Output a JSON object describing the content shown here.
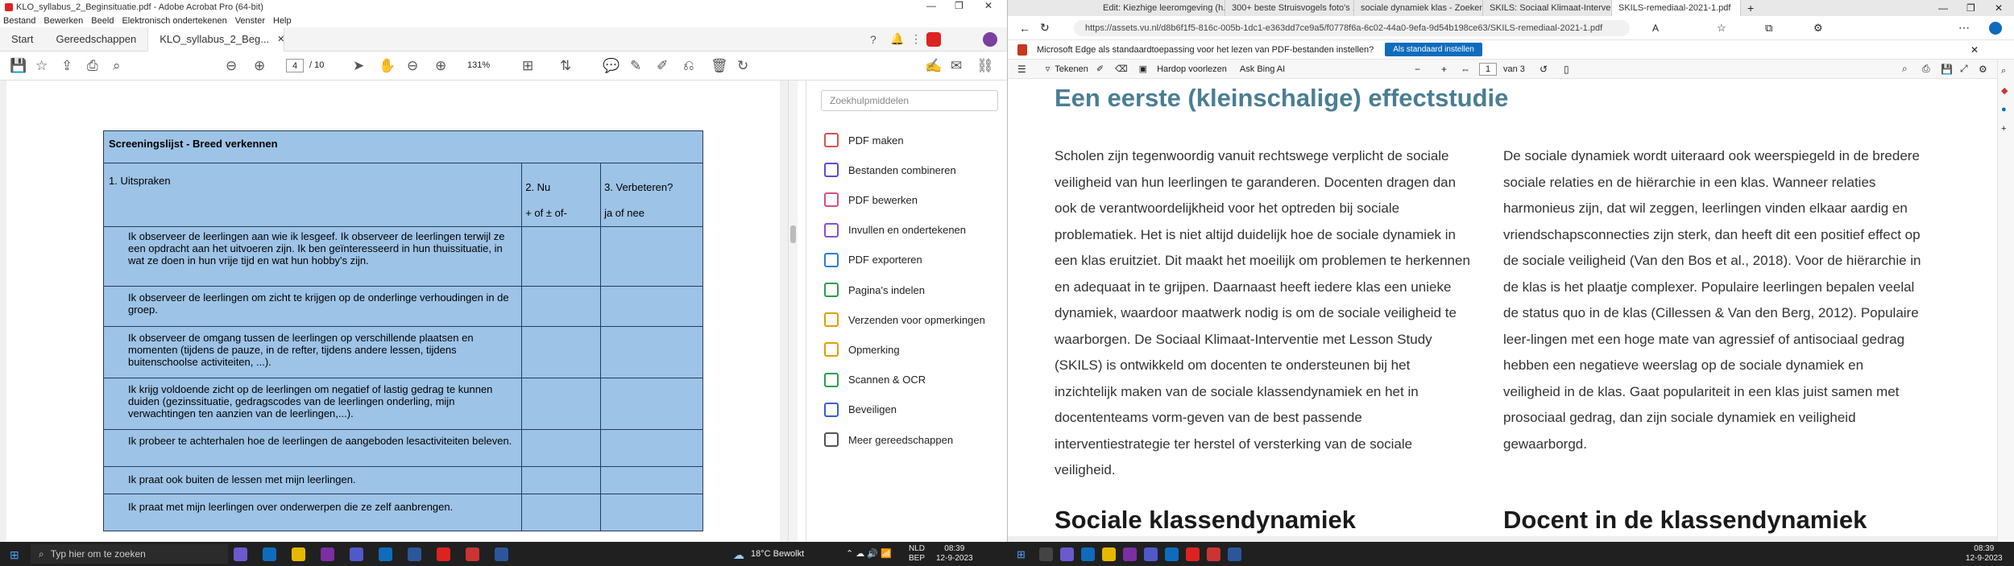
{
  "acrobat": {
    "title": "KLO_syllabus_2_Beginsituatie.pdf - Adobe Acrobat Pro (64-bit)",
    "menu": [
      "Bestand",
      "Bewerken",
      "Beeld",
      "Elektronisch ondertekenen",
      "Venster",
      "Help"
    ],
    "tabs": [
      "Start",
      "Gereedschappen"
    ],
    "doc_tab": "KLO_syllabus_2_Beg...",
    "page_current": "4",
    "page_total": "/ 10",
    "zoom": "131%",
    "search_placeholder": "Zoekhulpmiddelen",
    "tools": [
      {
        "label": "PDF maken",
        "color": "#d9534f"
      },
      {
        "label": "Bestanden combineren",
        "color": "#5a4fcf"
      },
      {
        "label": "PDF bewerken",
        "color": "#d94f7a"
      },
      {
        "label": "Invullen en ondertekenen",
        "color": "#8a4fd9"
      },
      {
        "label": "PDF exporteren",
        "color": "#2d7fd3"
      },
      {
        "label": "Pagina's indelen",
        "color": "#2e9e4f"
      },
      {
        "label": "Verzenden voor opmerkingen",
        "color": "#e0a000"
      },
      {
        "label": "Opmerking",
        "color": "#e0a000"
      },
      {
        "label": "Scannen & OCR",
        "color": "#2e9e4f"
      },
      {
        "label": "Beveiligen",
        "color": "#3a5fcf"
      },
      {
        "label": "Meer gereedschappen",
        "color": "#555555"
      }
    ],
    "table": {
      "title": "Screeningslijst - Breed verkennen",
      "h1": "1. Uitspraken",
      "h2a": "2. Nu",
      "h2b": "+ of ± of-",
      "h3a": "3. Verbeteren?",
      "h3b": "ja of nee",
      "rows": [
        "Ik observeer de leerlingen aan wie ik lesgeef. Ik observeer de leerlingen terwijl ze een opdracht aan het uitvoeren zijn. Ik ben geïnteresseerd in hun thuissituatie, in wat ze doen in hun vrije tijd en wat hun hobby's zijn.",
        "Ik observeer de leerlingen om zicht te krijgen op de onderlinge verhoudingen in de groep.",
        "Ik observeer de omgang tussen de leerlingen op verschillende plaatsen en momenten (tijdens de pauze, in de refter, tijdens andere lessen, tijdens buitenschoolse activiteiten, ...).",
        "Ik krijg voldoende zicht op de leerlingen om negatief of lastig gedrag te kunnen duiden (gezinssituatie, gedragscodes van de leerlingen onderling, mijn verwachtingen ten aanzien van de leerlingen,...).",
        "Ik probeer te achterhalen hoe de leerlingen de aangeboden lesactiviteiten beleven.",
        "Ik praat ook buiten de lessen met mijn leerlingen.",
        "Ik praat met mijn leerlingen over onderwerpen die ze zelf aanbrengen."
      ]
    }
  },
  "edge": {
    "tabs": [
      "Edit: Kiezhige leeromgeving (h...",
      "300+ beste Struisvogels foto's ...",
      "sociale dynamiek klas - Zoeken",
      "SKILS: Sociaal Klimaat-Interventi...",
      "SKILS-remediaal-2021-1.pdf"
    ],
    "url": "https://assets.vu.nl/d8b6f1f5-816c-005b-1dc1-e363dd7ce9a5/f0778f6a-6c02-44a0-9efa-9d54b198ce63/SKILS-remediaal-2021-1.pdf",
    "infobar": "Microsoft Edge als standaardtoepassing voor het lezen van PDF-bestanden instellen?",
    "infobtn": "Als standaard instellen",
    "pdftb": {
      "draw": "Tekenen",
      "page": "1",
      "of": "van 3",
      "read": "Hardop voorlezen",
      "ask": "Ask Bing AI"
    },
    "heading": "Een eerste (kleinschalige) effectstudie",
    "col1": "Scholen zijn tegenwoordig vanuit rechtswege verplicht de sociale veiligheid van hun leerlingen te garanderen. Docenten dragen dan ook de verantwoordelijkheid voor het optreden bij sociale problematiek. Het is niet altijd duidelijk hoe de sociale dynamiek in een klas eruitziet. Dit maakt het moeilijk om problemen te herkennen en adequaat in te grijpen. Daarnaast heeft iedere klas een unieke dynamiek, waardoor maatwerk nodig is om de sociale veiligheid te waarborgen. De Sociaal Klimaat-Interventie met Lesson Study (SKILS) is ontwikkeld om docenten te ondersteunen bij het inzichtelijk maken van de sociale klassendynamiek en het in docententeams vorm-geven van de best passende interventiestrategie ter herstel of versterking van de sociale veiligheid.",
    "col2": "De sociale dynamiek wordt uiteraard ook weerspiegeld in de bredere sociale relaties en de hiërarchie in een klas. Wanneer relaties harmonieus zijn, dat wil zeggen, leerlingen vinden elkaar aardig en vriendschapsconnecties zijn sterk, dan heeft dit een positief effect op de sociale veiligheid (Van den Bos et al., 2018). Voor de hiërarchie in de klas is het plaatje complexer. Populaire leerlingen bepalen veelal de status quo in de klas (Cillessen & Van den Berg, 2012). Populaire leer-lingen met een hoge mate van agressief of antisociaal gedrag hebben een negatieve weerslag op de sociale dynamiek en veiligheid in de klas. Gaat populariteit in een klas juist samen met prosociaal gedrag, dan zijn sociale dynamiek en veiligheid gewaarborgd.",
    "h_left": "Sociale klassendynamiek",
    "h_right": "Docent in de klassendynamiek"
  },
  "taskbar": {
    "search": "Typ hier om te zoeken",
    "weather": "18°C  Bewolkt",
    "lang1": "NLD",
    "lang2": "BEP",
    "time": "08:39",
    "date": "12-9-2023",
    "time2": "08:39",
    "date2": "12-9-2023"
  },
  "colors": {
    "table_fill": "#9dc3e6",
    "heading_teal": "#4a7e93",
    "edge_blue": "#0f6cbd"
  }
}
